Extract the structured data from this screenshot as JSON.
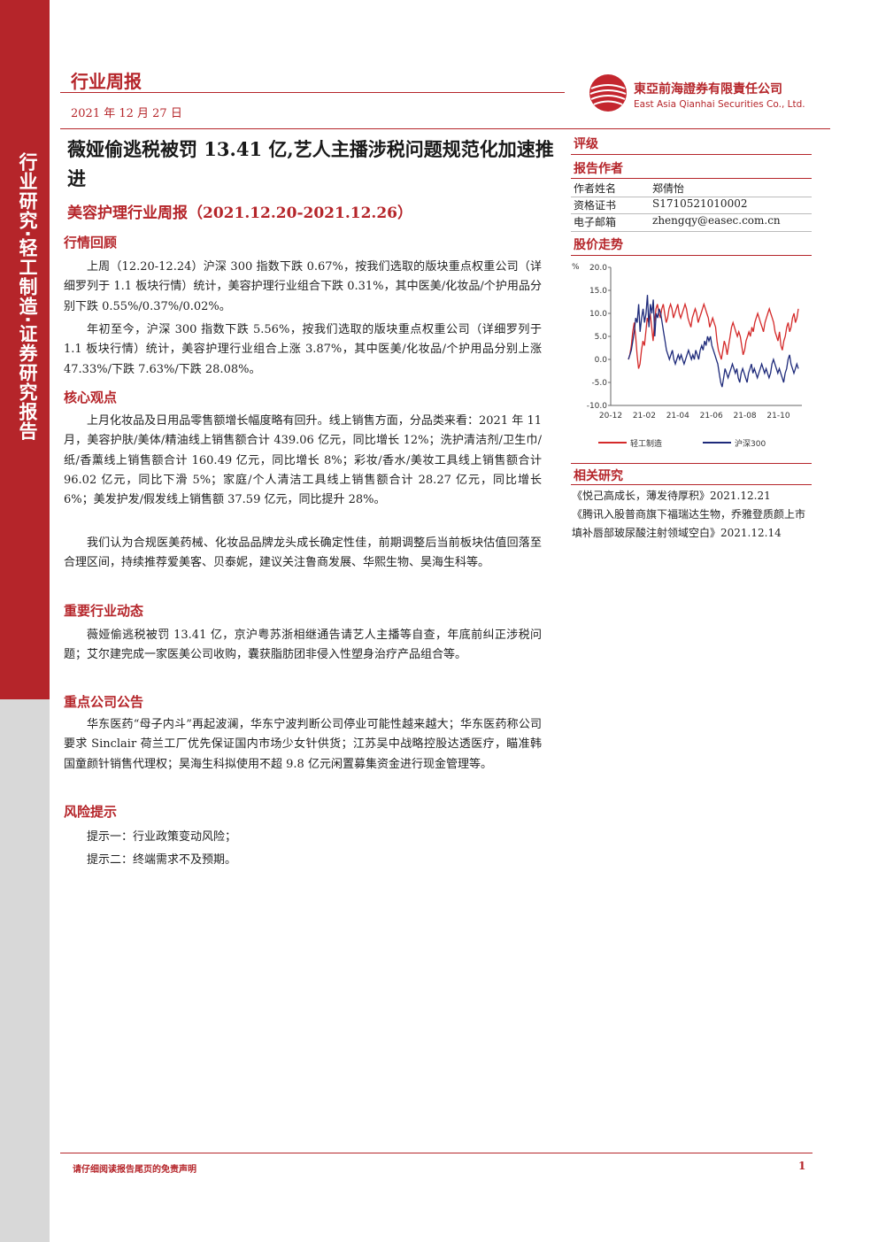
{
  "sidebar": {
    "text": "行业研究·轻工制造·证券研究报告"
  },
  "header": {
    "doc_type": "行业周报",
    "date": "2021 年 12 月 27 日",
    "company_cn": "東亞前海證券有限責任公司",
    "company_en": "East Asia Qianhai Securities Co., Ltd."
  },
  "title": {
    "main": "薇娅偷逃税被罚 13.41 亿,艺人主播涉税问题规范化加速推进",
    "sub": "美容护理行业周报（2021.12.20-2021.12.26）"
  },
  "sections": {
    "market_review": {
      "heading": "行情回顾",
      "p1": "上周（12.20-12.24）沪深 300 指数下跌 0.67%，按我们选取的版块重点权重公司（详细罗列于 1.1 板块行情）统计，美容护理行业组合下跌 0.31%，其中医美/化妆品/个护用品分别下跌 0.55%/0.37%/0.02%。",
      "p2": "年初至今，沪深 300 指数下跌 5.56%，按我们选取的版块重点权重公司（详细罗列于 1.1 板块行情）统计，美容护理行业组合上涨 3.87%，其中医美/化妆品/个护用品分别上涨 47.33%/下跌 7.63%/下跌 28.08%。"
    },
    "core_view": {
      "heading": "核心观点",
      "p1": "上月化妆品及日用品零售额增长幅度略有回升。线上销售方面，分品类来看：2021 年 11 月，美容护肤/美体/精油线上销售额合计 439.06 亿元，同比增长 12%；洗护清洁剂/卫生巾/纸/香薰线上销售额合计 160.49 亿元，同比增长 8%；彩妆/香水/美妆工具线上销售额合计 96.02 亿元，同比下滑 5%；家庭/个人清洁工具线上销售额合计 28.27 亿元，同比增长 6%；美发护发/假发线上销售额 37.59 亿元，同比提升 28%。",
      "p2": "我们认为合规医美药械、化妆品品牌龙头成长确定性佳，前期调整后当前板块估值回落至合理区间，持续推荐爱美客、贝泰妮，建议关注鲁商发展、华熙生物、昊海生科等。"
    },
    "industry_news": {
      "heading": "重要行业动态",
      "p1": "薇娅偷逃税被罚 13.41 亿，京沪粤苏浙相继通告请艺人主播等自查，年底前纠正涉税问题；艾尔建完成一家医美公司收购，囊获脂肪团非侵入性塑身治疗产品组合等。"
    },
    "company_notice": {
      "heading": "重点公司公告",
      "p1": "华东医药“母子内斗”再起波澜，华东宁波判断公司停业可能性越来越大；华东医药称公司要求 Sinclair 荷兰工厂优先保证国内市场少女针供货；江苏吴中战略控股达透医疗，瞄准韩国童颜针销售代理权；昊海生科拟使用不超 9.8 亿元闲置募集资金进行现金管理等。"
    },
    "risk": {
      "heading": "风险提示",
      "item1": "提示一：行业政策变动风险；",
      "item2": "提示二：终端需求不及预期。"
    }
  },
  "right_column": {
    "rating_heading": "评级",
    "author_heading": "报告作者",
    "author_name_label": "作者姓名",
    "author_name": "郑倩怡",
    "cert_label": "资格证书",
    "cert_value": "S1710521010002",
    "email_label": "电子邮箱",
    "email_value": "zhengqy@easec.com.cn",
    "chart_heading": "股价走势",
    "related_heading": "相关研究",
    "related_1": "《悦己高成长，薄发待厚积》2021.12.21",
    "related_2": "《腾讯入股普商旗下福瑞达生物，乔雅登质颜上市填补唇部玻尿酸注射领域空白》2021.12.14"
  },
  "chart_data": {
    "type": "line",
    "title": "",
    "ylabel": "%",
    "ylim": [
      -10,
      20
    ],
    "yticks": [
      "20.0",
      "15.0",
      "10.0",
      "5.0",
      "0.0",
      "-5.0",
      "-10.0"
    ],
    "xticks": [
      "20-12",
      "21-02",
      "21-04",
      "21-06",
      "21-08",
      "21-10"
    ],
    "grid": false,
    "legend_position": "bottom",
    "series": [
      {
        "name": "轻工制造",
        "color": "#d42a2a",
        "values": [
          0,
          1,
          3,
          6,
          8,
          5,
          1,
          -2,
          -1,
          2,
          4,
          3,
          6,
          9,
          8,
          10,
          7,
          4,
          8,
          11,
          12,
          10,
          9,
          11,
          12,
          10,
          8,
          9,
          11,
          12,
          11,
          9,
          10,
          11,
          12,
          10,
          9,
          10,
          11,
          12,
          11,
          9,
          8,
          7,
          9,
          10,
          11,
          10,
          8,
          9,
          10,
          11,
          12,
          11,
          10,
          9,
          7,
          8,
          9,
          8,
          7,
          4,
          2,
          1,
          0,
          2,
          4,
          3,
          1,
          3,
          5,
          7,
          8,
          7,
          6,
          5,
          6,
          5,
          3,
          1,
          2,
          4,
          5,
          6,
          5,
          7,
          6,
          8,
          9,
          10,
          9,
          8,
          7,
          6,
          8,
          9,
          10,
          11,
          10,
          9,
          8,
          6,
          5,
          4,
          6,
          3,
          2,
          4,
          5,
          7,
          8,
          6,
          7,
          9,
          10,
          8,
          9,
          11
        ]
      },
      {
        "name": "沪深300",
        "color": "#1e2a7a",
        "values": [
          0,
          1,
          2,
          4,
          6,
          9,
          8,
          12,
          6,
          9,
          11,
          8,
          10,
          14,
          7,
          12,
          10,
          13,
          5,
          10,
          9,
          11,
          10,
          8,
          6,
          4,
          2,
          1,
          0,
          1,
          2,
          0,
          -1,
          0,
          1,
          0,
          1,
          0,
          -1,
          0,
          1,
          2,
          1,
          0,
          1,
          0,
          2,
          1,
          0,
          2,
          3,
          2,
          4,
          3,
          5,
          4,
          5,
          3,
          2,
          1,
          0,
          -1,
          -3,
          -5,
          -6,
          -4,
          -2,
          -3,
          -4,
          -3,
          -2,
          -1,
          -2,
          -3,
          -2,
          -4,
          -5,
          -3,
          -2,
          -3,
          -4,
          -5,
          -3,
          -2,
          -1,
          -3,
          -2,
          -3,
          -4,
          -3,
          -2,
          -1,
          -2,
          -3,
          -2,
          -3,
          -4,
          -3,
          -1,
          0,
          -1,
          -2,
          -3,
          -2,
          -3,
          -4,
          -5,
          -3,
          -2,
          0,
          1,
          -1,
          -2,
          -3,
          -2,
          -1,
          -2
        ]
      }
    ]
  },
  "footer": {
    "disclaimer": "请仔细阅读报告尾页的免责声明",
    "page": "1"
  }
}
